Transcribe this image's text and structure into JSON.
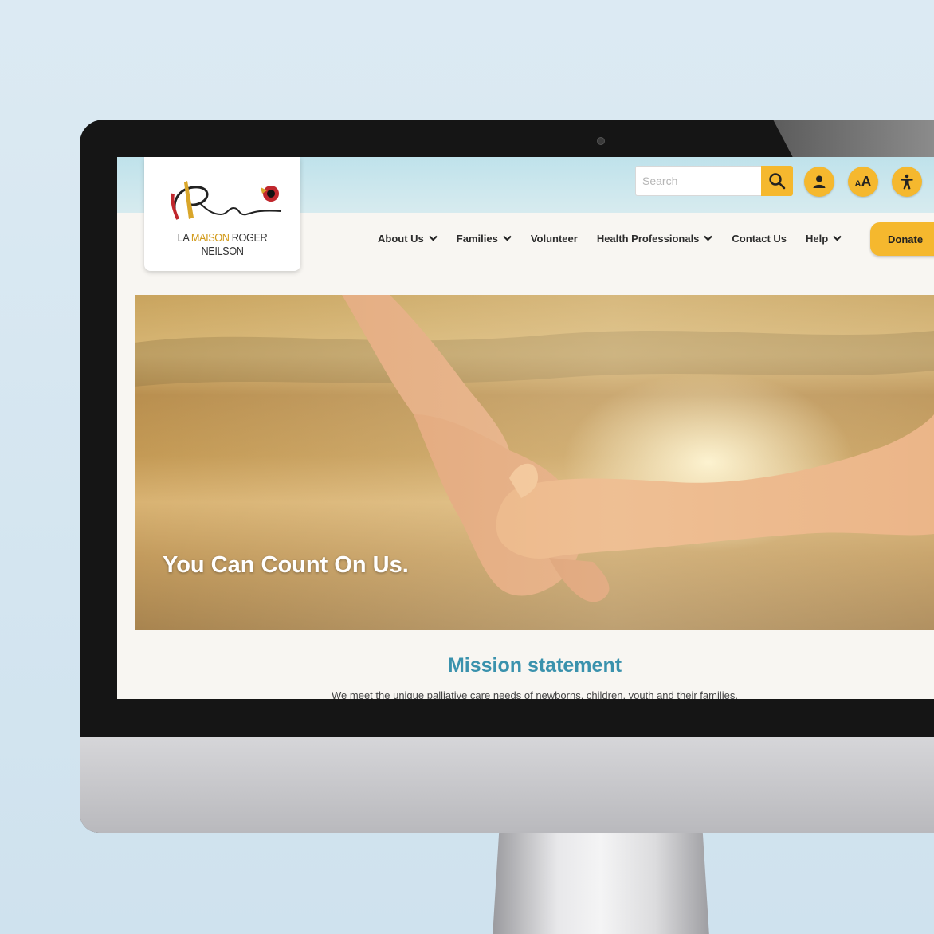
{
  "site": {
    "logo": {
      "signature": "Roger",
      "name_prefix": "LA",
      "name_highlight": "MAISON",
      "name_suffix": "ROGER NEILSON"
    }
  },
  "search": {
    "placeholder": "Search"
  },
  "utility": {
    "text_size_small": "A",
    "text_size_large": "A"
  },
  "nav": {
    "items": [
      {
        "label": "About Us",
        "dropdown": true
      },
      {
        "label": "Families",
        "dropdown": true
      },
      {
        "label": "Volunteer",
        "dropdown": false
      },
      {
        "label": "Health Professionals",
        "dropdown": true
      },
      {
        "label": "Contact Us",
        "dropdown": false
      },
      {
        "label": "Help",
        "dropdown": true
      }
    ],
    "donate_label": "Donate"
  },
  "hero": {
    "title": "You Can Count On Us."
  },
  "mission": {
    "title": "Mission statement",
    "text": "We meet the unique palliative care needs of newborns, children, youth and their families."
  },
  "colors": {
    "accent": "#f5b82e",
    "mission_title": "#3a92ad",
    "topband": "#bfe2eb"
  }
}
